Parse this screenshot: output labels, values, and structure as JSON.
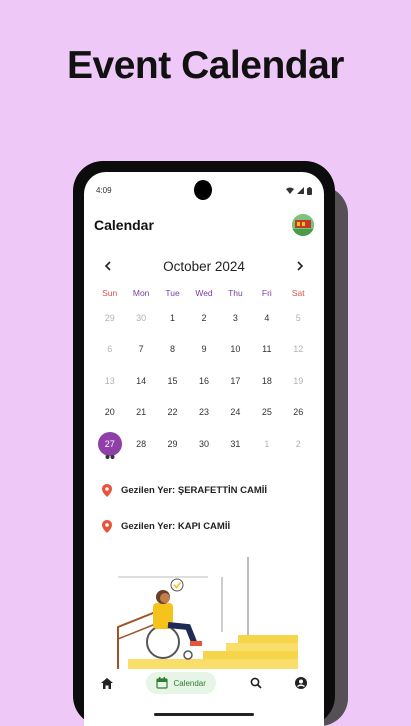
{
  "hero": {
    "title": "Event Calendar"
  },
  "status_bar": {
    "time": "4:09"
  },
  "app": {
    "title": "Calendar"
  },
  "calendar": {
    "month_label": "October 2024",
    "prev_icon": "chevron-left-icon",
    "next_icon": "chevron-right-icon",
    "weekdays": [
      "Sun",
      "Mon",
      "Tue",
      "Wed",
      "Thu",
      "Fri",
      "Sat"
    ],
    "weeks": [
      [
        "29",
        "30",
        "1",
        "2",
        "3",
        "4",
        "5"
      ],
      [
        "6",
        "7",
        "8",
        "9",
        "10",
        "11",
        "12"
      ],
      [
        "13",
        "14",
        "15",
        "16",
        "17",
        "18",
        "19"
      ],
      [
        "20",
        "21",
        "22",
        "23",
        "24",
        "25",
        "26"
      ],
      [
        "27",
        "28",
        "29",
        "30",
        "31",
        "1",
        "2"
      ]
    ],
    "selected_day": "27"
  },
  "events": [
    {
      "label": "Gezilen Yer: ŞERAFETTİN CAMİİ"
    },
    {
      "label": "Gezilen Yer: KAPI CAMİİ"
    }
  ],
  "bottom_nav": {
    "items": [
      "home-icon",
      "calendar-icon",
      "search-icon",
      "account-icon"
    ],
    "active_label": "Calendar"
  },
  "colors": {
    "background": "#eec8f6",
    "accent": "#8e3fa8",
    "weekend": "#d9534f",
    "nav_active": "#2e7d32",
    "pin": "#e8543a"
  }
}
